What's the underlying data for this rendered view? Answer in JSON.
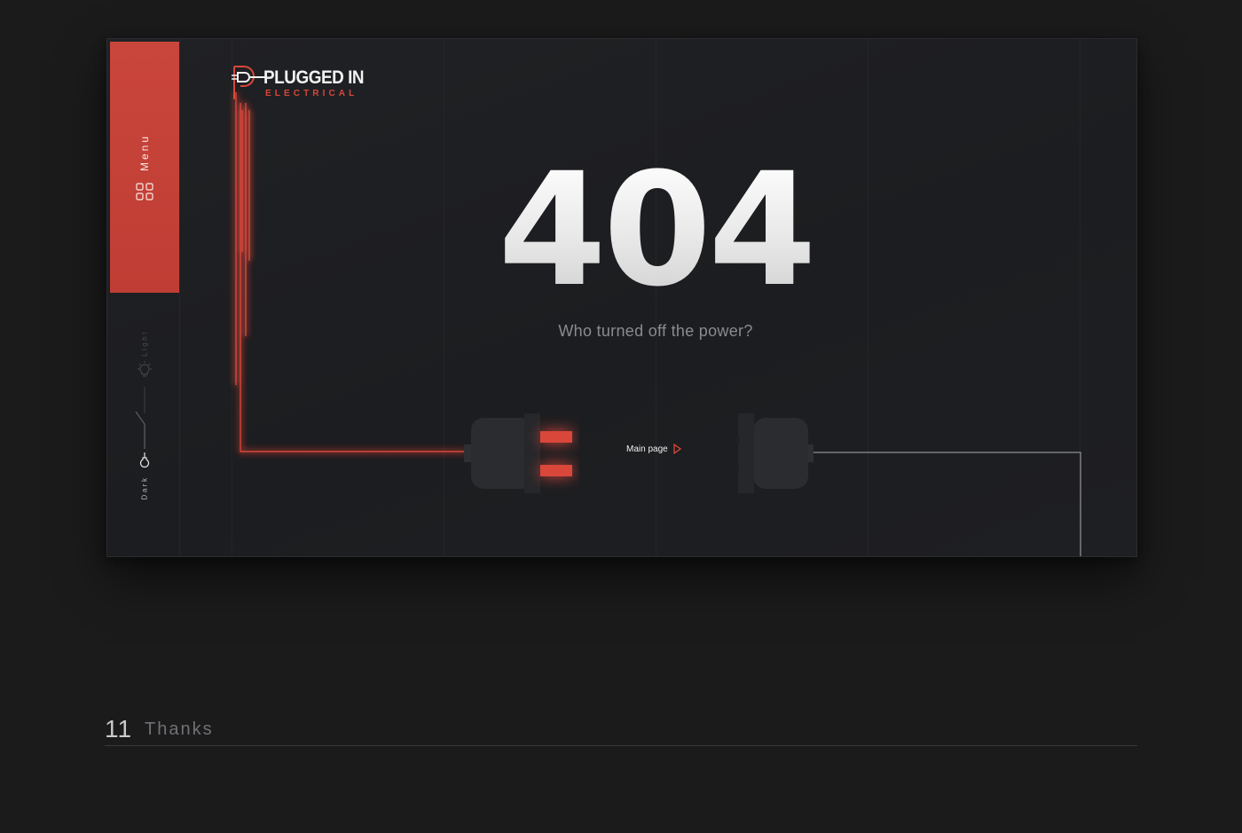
{
  "brand": {
    "name": "PLUGGED IN",
    "tagline": "ELECTRICAL",
    "accent_color": "#d9473b"
  },
  "sidebar": {
    "menu_label": "Menu",
    "menu_icon": "grid-icon",
    "mode_light_label": "Light",
    "mode_dark_label": "Dark",
    "current_mode": "Dark"
  },
  "error": {
    "code": "404",
    "message": "Who turned off the power?"
  },
  "navigation": {
    "main_page_label": "Main page",
    "main_page_icon": "play-triangle-icon"
  },
  "footer": {
    "number": "11",
    "title": "Thanks"
  }
}
